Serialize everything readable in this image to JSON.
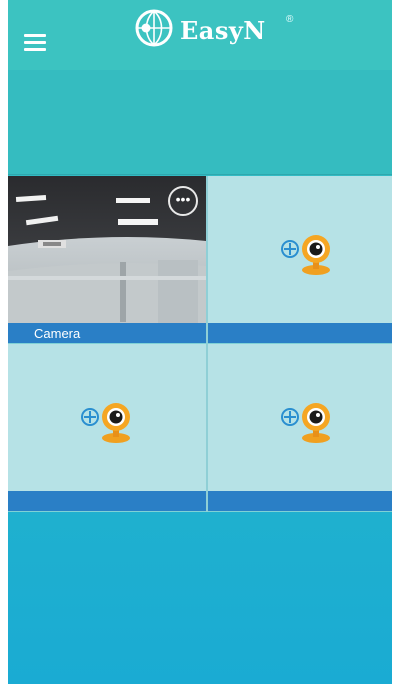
{
  "app": {
    "logo_text": "EasyN",
    "registered_mark": "®"
  },
  "colors": {
    "header": "#3cc3c1",
    "accent_bar": "#2a7fc6",
    "tile": "#b6e2e6",
    "background_bottom": "#1aabd3"
  },
  "header": {
    "menu_icon": "hamburger-menu-icon"
  },
  "camera_grid": {
    "tiles": [
      {
        "label": "Camera",
        "has_feed": true,
        "overlay_icon": "more-options-icon",
        "overlay_glyph": "•••"
      },
      {
        "label": "",
        "has_feed": false,
        "icon": "add-camera-icon"
      },
      {
        "label": "",
        "has_feed": false,
        "icon": "add-camera-icon"
      },
      {
        "label": "",
        "has_feed": false,
        "icon": "add-camera-icon"
      }
    ]
  }
}
